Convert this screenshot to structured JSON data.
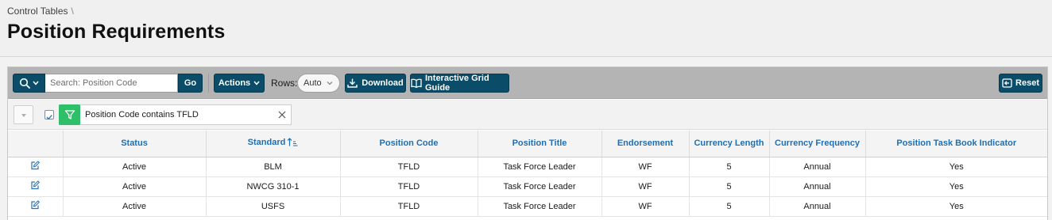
{
  "breadcrumb": {
    "parent": "Control Tables",
    "separator": "\\"
  },
  "page": {
    "title": "Position Requirements"
  },
  "toolbar": {
    "search_placeholder": "Search: Position Code",
    "go_label": "Go",
    "actions_label": "Actions",
    "rows_label": "Rows:",
    "rows_value": "Auto",
    "download_label": "Download",
    "guide_label": "Interactive Grid Guide",
    "reset_label": "Reset"
  },
  "filter": {
    "text": "Position Code contains TFLD",
    "enabled": true
  },
  "grid": {
    "columns": [
      "Status",
      "Standard",
      "Position Code",
      "Position Title",
      "Endorsement",
      "Currency Length",
      "Currency Frequency",
      "Position Task Book Indicator"
    ],
    "sorted_column": "Standard",
    "sort_direction": "ascending",
    "rows": [
      [
        "Active",
        "BLM",
        "TFLD",
        "Task Force Leader",
        "WF",
        "5",
        "Annual",
        "Yes"
      ],
      [
        "Active",
        "NWCG 310-1",
        "TFLD",
        "Task Force Leader",
        "WF",
        "5",
        "Annual",
        "Yes"
      ],
      [
        "Active",
        "USFS",
        "TFLD",
        "Task Force Leader",
        "WF",
        "5",
        "Annual",
        "Yes"
      ]
    ]
  },
  "colors": {
    "button": "#0b4c68",
    "header_text": "#1f6fb2",
    "filter_icon": "#2ebf68",
    "toolbar_bg": "#b4b4b4"
  }
}
